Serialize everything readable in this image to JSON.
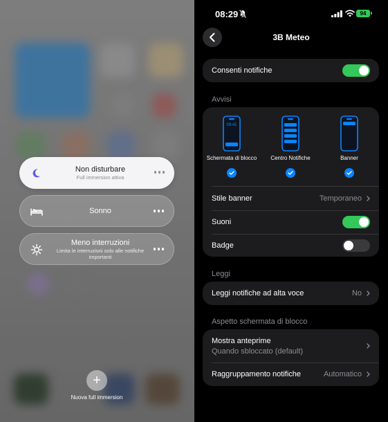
{
  "focus_menu": {
    "items": [
      {
        "title": "Non disturbare",
        "subtitle": "Full immersion attiva"
      },
      {
        "title": "Sonno",
        "subtitle": ""
      },
      {
        "title": "Meno interruzioni",
        "subtitle": "Limita le interruzioni solo alle notifiche importanti"
      }
    ],
    "new_focus_label": "Nuova full immersion"
  },
  "status_bar": {
    "time": "08:29",
    "battery": "94"
  },
  "header": {
    "title": "3B Meteo"
  },
  "allow_notifications": {
    "label": "Consenti notifiche",
    "enabled": true
  },
  "alerts": {
    "section_title": "Avvisi",
    "lock_time": "09:41",
    "options": [
      {
        "label": "Schermata di blocco",
        "checked": true
      },
      {
        "label": "Centro Notifiche",
        "checked": true
      },
      {
        "label": "Banner",
        "checked": true
      }
    ],
    "banner_style": {
      "label": "Stile banner",
      "value": "Temporaneo"
    },
    "sounds": {
      "label": "Suoni",
      "enabled": true
    },
    "badges": {
      "label": "Badge",
      "enabled": false
    }
  },
  "announce": {
    "section_title": "Leggi",
    "label": "Leggi notifiche ad alta voce",
    "value": "No"
  },
  "lock_screen": {
    "section_title": "Aspetto schermata di blocco",
    "show_previews": {
      "label": "Mostra anteprime",
      "value": "Quando sbloccato (default)"
    },
    "grouping": {
      "label": "Raggruppamento notifiche",
      "value": "Automatico"
    }
  },
  "colors": {
    "accent": "#34c759",
    "check": "#0a84ff",
    "card": "#1c1c1e"
  }
}
